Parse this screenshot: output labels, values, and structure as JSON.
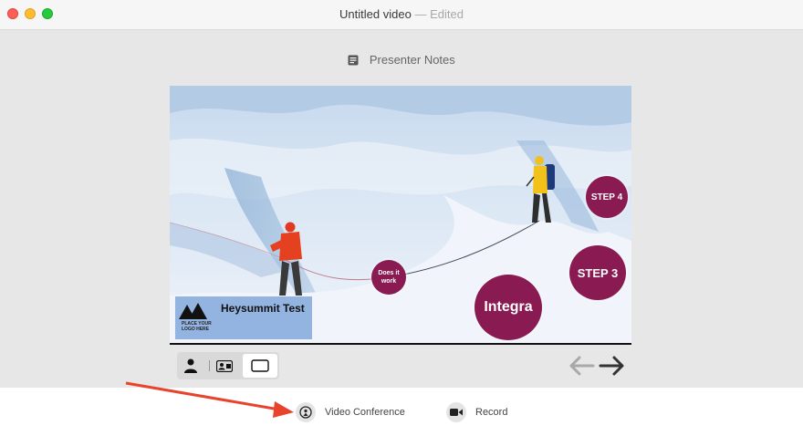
{
  "window": {
    "title": "Untitled video",
    "title_suffix": "— Edited"
  },
  "toolbar": {
    "presenter_notes_label": "Presenter Notes",
    "presenter_notes_icon": "notes-icon"
  },
  "slide": {
    "circles": {
      "step4": "STEP 4",
      "step3": "STEP 3",
      "integra": "Integra",
      "does_it_work": "Does it work"
    },
    "logo_block": {
      "logo_placeholder": "PLACE YOUR LOGO HERE",
      "title": "Heysummit Test"
    },
    "colors": {
      "circle": "#8a1a52",
      "logo_block_bg": "#93b3e0"
    }
  },
  "layout_buttons": [
    {
      "name": "presenter-only",
      "icon": "person-icon"
    },
    {
      "name": "presenter-card",
      "icon": "contact-card-icon"
    },
    {
      "name": "slide-only",
      "icon": "rectangle-icon",
      "selected": true
    }
  ],
  "navigation": {
    "prev_icon": "arrow-left-icon",
    "next_icon": "arrow-right-icon"
  },
  "actions": {
    "video_conference": "Video Conference",
    "record": "Record"
  },
  "annotation": {
    "arrow_color": "#e8432d"
  }
}
